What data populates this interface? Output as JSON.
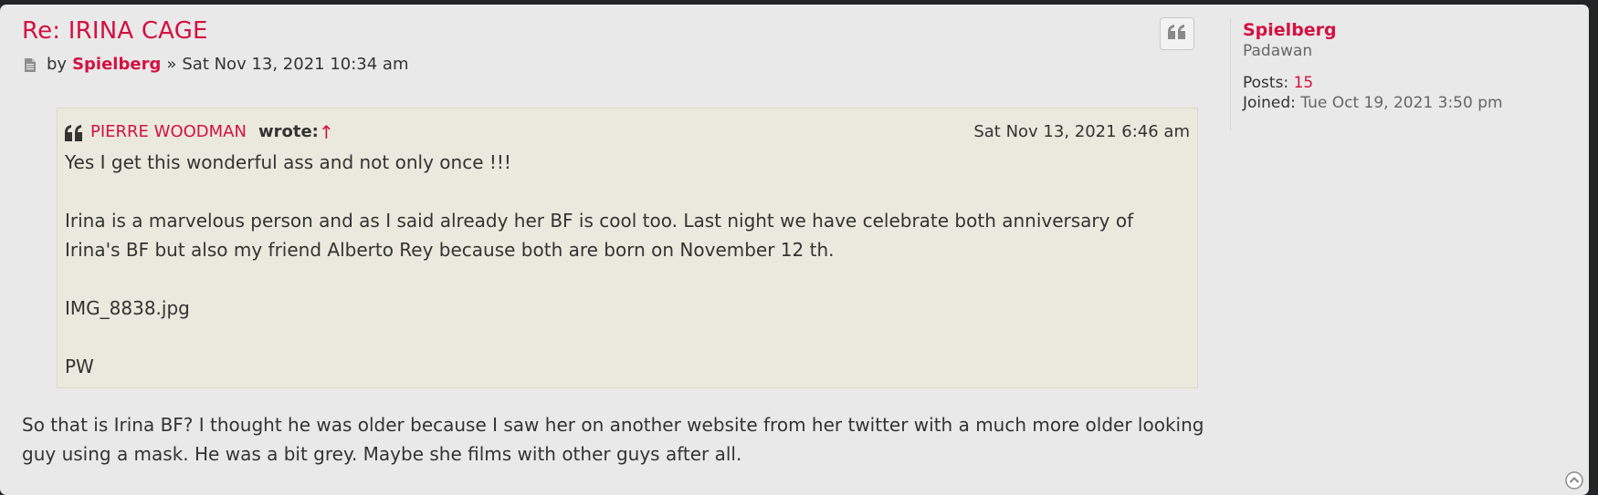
{
  "post": {
    "title": "Re: IRINA CAGE",
    "byline_by": "by",
    "author": "Spielberg",
    "byline_sep": "»",
    "date": "Sat Nov 13, 2021 10:34 am",
    "quote_button_icon": "quote-icon",
    "quote": {
      "author": "PIERRE WOODMAN",
      "wrote": "wrote:",
      "link_arrow": "↑",
      "date": "Sat Nov 13, 2021 6:46 am",
      "paragraphs": [
        "Yes I get this wonderful ass and not only once !!!",
        "Irina is a marvelous person and as I said already her BF is cool too. Last night we have celebrate both anniversary of Irina's BF but also my friend Alberto Rey because both are born on November 12 th.",
        "IMG_8838.jpg",
        "PW"
      ]
    },
    "content": "So that is Irina BF? I thought he was older because I saw her on another website from her twitter with a much more older looking guy using a mask. He was a bit grey. Maybe she films with other guys after all."
  },
  "profile": {
    "name": "Spielberg",
    "rank": "Padawan",
    "posts_label": "Posts:",
    "posts_value": "15",
    "joined_label": "Joined:",
    "joined_value": "Tue Oct 19, 2021 3:50 pm"
  },
  "colors": {
    "accent": "#d31141",
    "post_bg": "#e9e9e9",
    "quote_bg": "#ebe9dd",
    "page_bg": "#222425"
  }
}
